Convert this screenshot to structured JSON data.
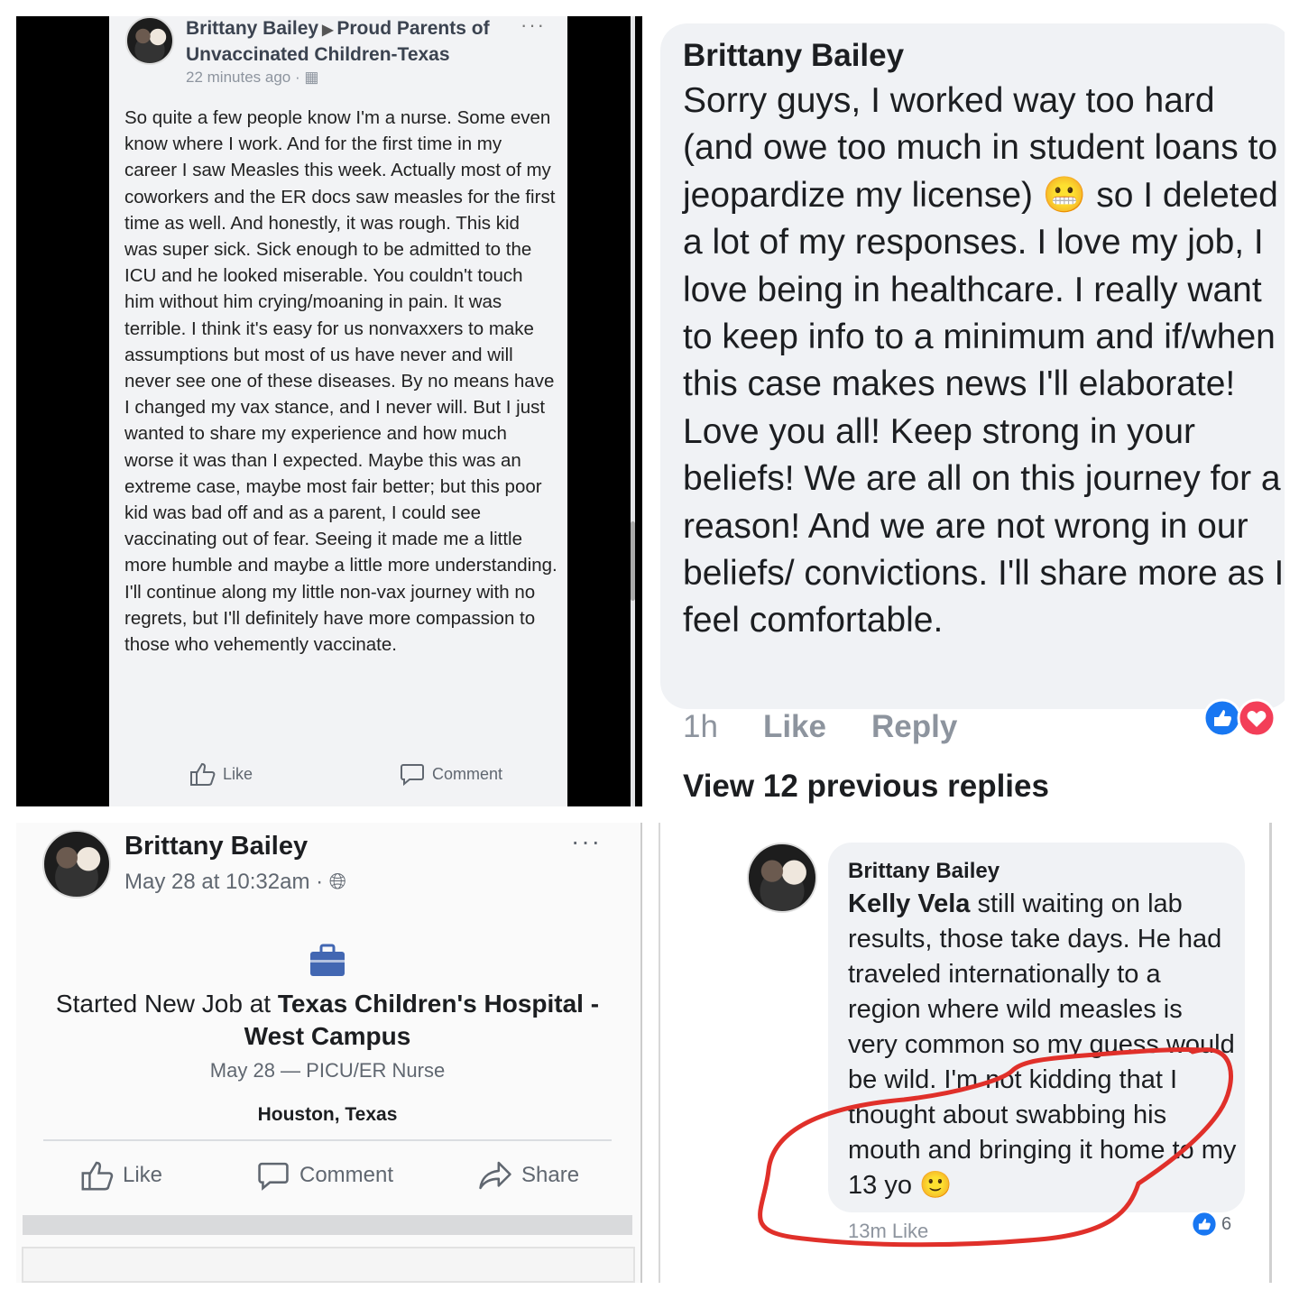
{
  "panel1": {
    "author": "Brittany Bailey",
    "group": "Proud Parents of Unvaccinated Children-Texas",
    "timestamp": "22 minutes ago",
    "body": "So quite a few people know I'm a nurse. Some even know where I work. And for the first time in my career I saw Measles this week. Actually most of my coworkers and the ER docs saw measles for the first time as well. And honestly, it was rough. This kid was super sick. Sick enough to be admitted to the ICU and he looked miserable. You couldn't touch him without him crying/moaning in pain. It was terrible. I think it's easy for us nonvaxxers to make assumptions but most of us have never and will never see one of these diseases. By no means have I changed my vax stance, and I never will. But I just wanted to share my experience and how much worse it was than I expected. Maybe this was an extreme case, maybe most fair better; but this poor kid was bad off and as a parent, I could see vaccinating out of fear. Seeing it made me a little more humble and maybe a little more understanding. I'll continue along my little non-vax journey with no regrets, but I'll definitely have more compassion to those who vehemently vaccinate.",
    "like_label": "Like",
    "comment_label": "Comment"
  },
  "panel2": {
    "author": "Brittany Bailey",
    "text": "Sorry guys, I worked way too hard (and owe too much in student loans to jeopardize my license) 😬 so I deleted a lot of my responses. I love my job, I love being in healthcare. I really want to keep info to a minimum and if/when this case makes news I'll elaborate! Love you all! Keep strong in your beliefs! We are all on this journey for a reason! And we are not wrong in our beliefs/ convictions. I'll share more as I feel comfortable.",
    "time": "1h",
    "like_label": "Like",
    "reply_label": "Reply",
    "view_replies": "View 12 previous replies"
  },
  "panel3": {
    "author": "Brittany Bailey",
    "timestamp": "May 28 at 10:32am",
    "job_prefix": "Started New Job at ",
    "job_employer": "Texas Children's Hospital - West Campus",
    "job_detail": "May 28 — PICU/ER Nurse",
    "location": "Houston, Texas",
    "like_label": "Like",
    "comment_label": "Comment",
    "share_label": "Share"
  },
  "panel4": {
    "author": "Brittany Bailey",
    "mention": "Kelly Vela",
    "text": " still waiting on lab results, those take days. He had traveled internationally to a region where wild measles is very common so my guess would be wild. I'm not kidding that I thought about swabbing his mouth and bringing it home to my 13 yo 🙂",
    "meta": "13m   Like",
    "like_count": "6",
    "highlight_color": "#e0302a"
  },
  "colors": {
    "like_blue": "#1877f2",
    "love_red": "#f33e58"
  }
}
